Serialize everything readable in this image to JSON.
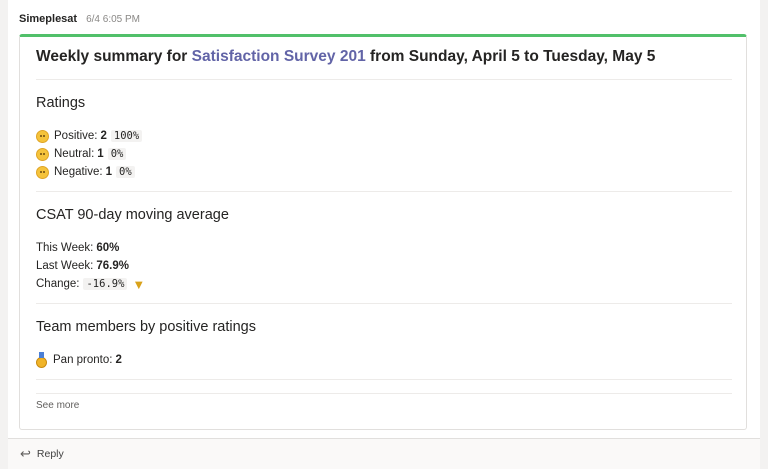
{
  "message": {
    "sender": "Simeplesat",
    "timestamp": "6/4 6:05 PM"
  },
  "card": {
    "title": {
      "prefix": "Weekly summary for ",
      "survey_link": "Satisfaction Survey 201",
      "suffix": " from Sunday, April 5 to Tuesday, May 5"
    },
    "ratings": {
      "heading": "Ratings",
      "items": [
        {
          "label": "Positive:",
          "count": "2",
          "percent": "100%",
          "icon": "slightly-smiling-face-icon"
        },
        {
          "label": "Neutral:",
          "count": "1",
          "percent": "0%",
          "icon": "neutral-face-icon"
        },
        {
          "label": "Negative:",
          "count": "1",
          "percent": "0%",
          "icon": "frowning-face-icon"
        }
      ]
    },
    "csat": {
      "heading": "CSAT 90-day moving average",
      "this_week_label": "This Week:",
      "this_week_value": "60%",
      "last_week_label": "Last Week:",
      "last_week_value": "76.9%",
      "change_label": "Change:",
      "change_value": "-16.9%",
      "change_icon": "thumbs-down-icon"
    },
    "team": {
      "heading": "Team members by positive ratings",
      "members": [
        {
          "name": "Pan pronto:",
          "count": "2",
          "icon": "gold-medal-icon"
        }
      ]
    },
    "see_more": "See more"
  },
  "reply": {
    "label": "Reply",
    "icon": "reply-arrow-icon"
  },
  "colors": {
    "accent": "#51c06a",
    "link": "#6264a7"
  }
}
